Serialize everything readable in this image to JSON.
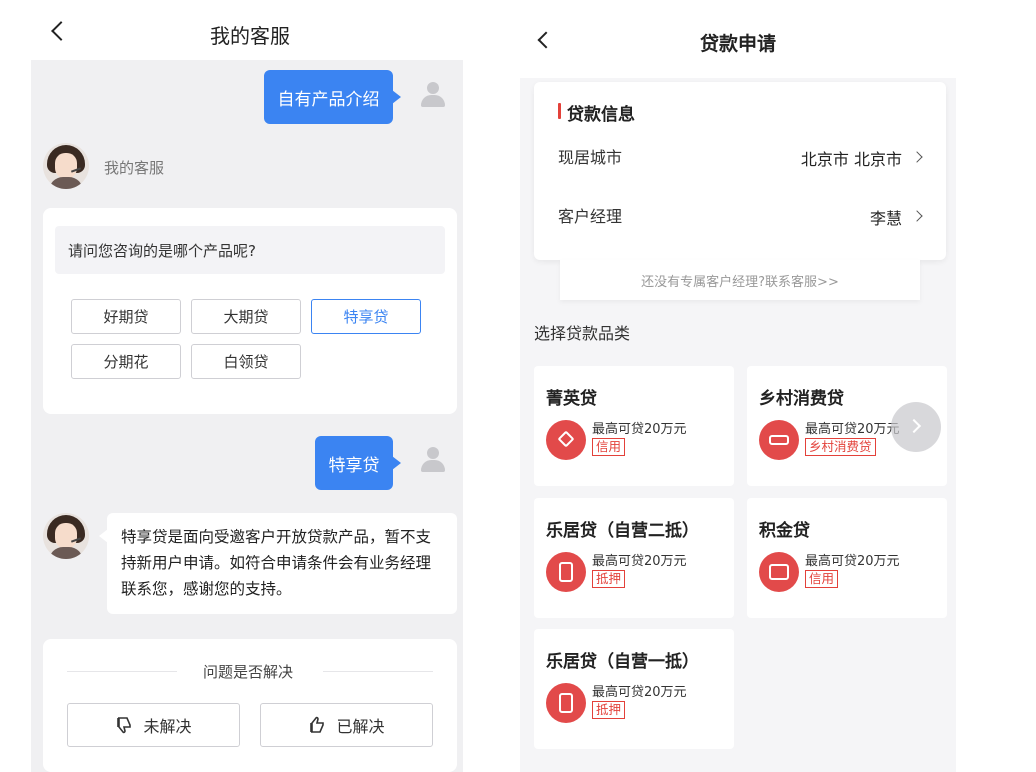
{
  "left": {
    "header": {
      "title": "我的客服"
    },
    "messages": {
      "user1": "自有产品介绍",
      "agent_name": "我的客服",
      "question": "请问您咨询的是哪个产品呢?",
      "options": [
        "好期贷",
        "大期贷",
        "特享贷",
        "分期花",
        "白领贷"
      ],
      "selected_option": "特享贷",
      "user2": "特享贷",
      "agent_reply_lines": [
        "特享贷是面向受邀客户开放贷款产品，暂不支",
        "持新用户申请。如符合申请条件会有业务经理",
        "联系您，感谢您的支持。"
      ]
    },
    "feedback": {
      "title": "问题是否解决",
      "unsolved": "未解决",
      "solved": "已解决"
    }
  },
  "right": {
    "header": {
      "title": "贷款申请"
    },
    "loan_info": {
      "title": "贷款信息",
      "city_label": "现居城市",
      "city_value": "北京市 北京市",
      "manager_label": "客户经理",
      "manager_value": "李慧"
    },
    "contact_link": "还没有专属客户经理?联系客服>>",
    "category_heading": "选择贷款品类",
    "products": [
      {
        "name": "菁英贷",
        "amount": "最高可贷20万元",
        "tag": "信用",
        "icon": "tie-icon"
      },
      {
        "name": "乡村消费贷",
        "amount": "最高可贷20万元",
        "tag": "乡村消费贷",
        "icon": "handshake-icon"
      },
      {
        "name": "乐居贷（自营二抵）",
        "amount": "最高可贷20万元",
        "tag": "抵押",
        "icon": "building-icon"
      },
      {
        "name": "积金贷",
        "amount": "最高可贷20万元",
        "tag": "信用",
        "icon": "wallet-icon"
      },
      {
        "name": "乐居贷（自营一抵）",
        "amount": "最高可贷20万元",
        "tag": "抵押",
        "icon": "building-icon"
      }
    ],
    "accent_color": "#e3413a"
  },
  "colors": {
    "chat_blue": "#3b84f2"
  }
}
